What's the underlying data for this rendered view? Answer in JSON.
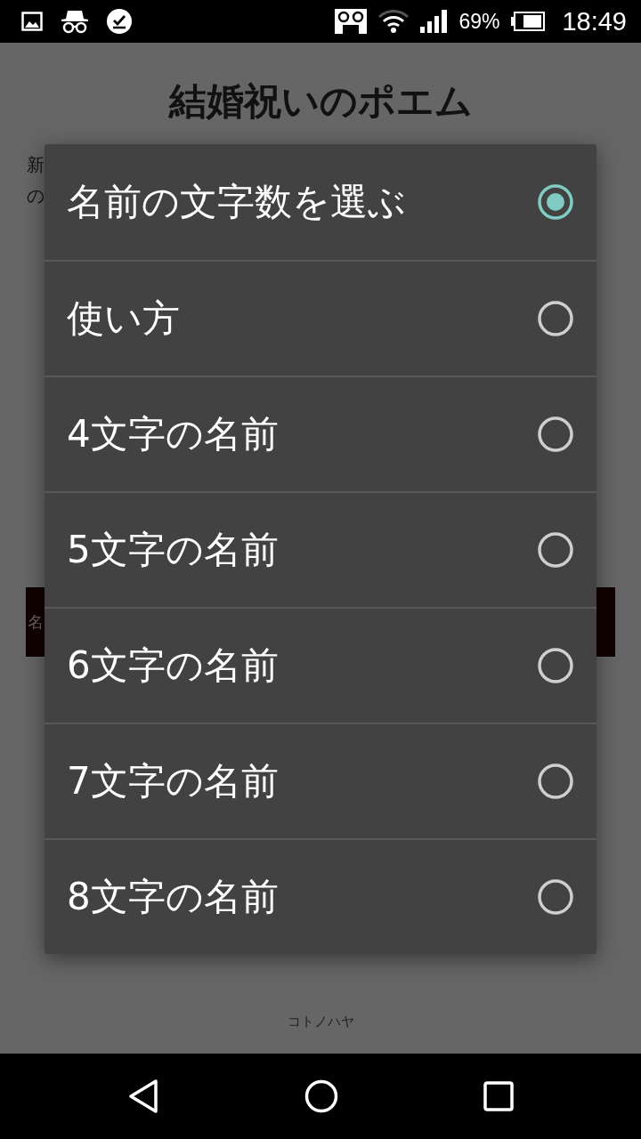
{
  "status_bar": {
    "battery": "69%",
    "time": "18:49"
  },
  "page": {
    "title": "結婚祝いのポエム",
    "intro_lines": [
      "新",
      "の"
    ],
    "button": "名",
    "footer": "コトノハヤ"
  },
  "dialog": {
    "options": [
      {
        "label": "名前の文字数を選ぶ",
        "selected": true
      },
      {
        "label": "使い方",
        "selected": false
      },
      {
        "label": "4文字の名前",
        "selected": false
      },
      {
        "label": "5文字の名前",
        "selected": false
      },
      {
        "label": "6文字の名前",
        "selected": false
      },
      {
        "label": "7文字の名前",
        "selected": false
      },
      {
        "label": "8文字の名前",
        "selected": false
      }
    ]
  }
}
